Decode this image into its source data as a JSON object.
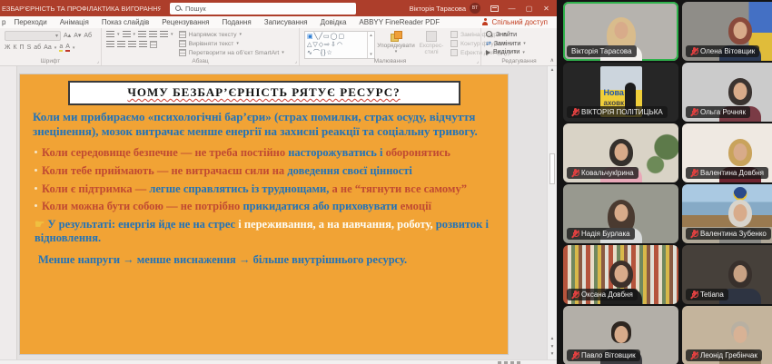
{
  "window": {
    "title": "ЕЗБАР’ЄРНІСТЬ ТА ПРОФІЛАКТИКА ВИГОРАННЯ - PowerPoint",
    "search_placeholder": "Пошук",
    "user_name": "Вікторія Тарасова",
    "user_initials": "ВТ",
    "minimize": "—",
    "restore": "▢",
    "close": "✕"
  },
  "ribbon": {
    "tab_partial": "р",
    "tabs": [
      "Переходи",
      "Анімація",
      "Показ слайдів",
      "Рецензування",
      "Подання",
      "Записування",
      "Довідка",
      "ABBYY FineReader PDF"
    ],
    "share_label": "Спільний доступ",
    "groups": {
      "font": "Шрифт",
      "paragraph": "Абзац",
      "drawing": "Малювання",
      "editing": "Редагування"
    },
    "paragraph_buttons": [
      "Напрямок тексту",
      "Вирівняти текст",
      "Перетворити на об’єкт SmartArt"
    ],
    "drawing_buttons": {
      "arrange": "Упорядкувати",
      "quick_styles_1": "Експрес-",
      "quick_styles_2": "стилі",
      "replace_shape": "Заміна фігури",
      "shape_outline": "Контур фігури",
      "shape_effects": "Ефекти для фігур"
    },
    "editing_buttons": {
      "find": "Знайти",
      "replace": "Замінити",
      "select": "Виділити"
    }
  },
  "slide": {
    "title": "ЧОМУ БЕЗБАР’ЄРНІСТЬ РЯТУЄ РЕСУРС?",
    "intro": "Коли ми прибираємо «психологічні бар’єри» (страх помилки, страх осуду, відчуття знецінення), мозок витрачає менше енергії на захисні реакції та соціальну тривогу.",
    "colors": {
      "background": "#F1A335",
      "blue": "#2173B9",
      "red": "#C04A32",
      "white": "#FDFDF5",
      "speaking_green": "#2FB24C"
    },
    "bullets": [
      {
        "s0": "Коли середовище безпечне — не треба постійно ",
        "s1": "насторожуватись і ",
        "s2": "оборонятись"
      },
      {
        "s0": "Коли тебе приймають — не витрачаєш сили на ",
        "s1": "доведення своєї цінності"
      },
      {
        "s0": "Коли є підтримка — ",
        "s1": "легше справлятись із труднощами, ",
        "s2": "а не “тягнути все самому”"
      },
      {
        "s0": "Коли можна бути собою — не потрібно ",
        "s1": "прикидатися або приховувати ",
        "s2": "емоції"
      },
      {
        "hand": "☛ ",
        "s0": "У результаті: ",
        "s1": "енергія йде не на стрес ",
        "s2": "і переживання, а на навчання, роботу, ",
        "s3": "розвиток і відновлення."
      },
      {
        "s0": "Менше напруги → менше виснаження → більше внутрішнього ресурсу."
      }
    ]
  },
  "meeting": {
    "participants": [
      {
        "name": "Вікторія Тарасова",
        "muted": false,
        "speaking": true
      },
      {
        "name": "Олена Вітовщик",
        "muted": true
      },
      {
        "name": "ВІКТОРІЯ ПОЛІТИЦЬКА",
        "muted": true,
        "poster_line1": "Нова",
        "poster_line2": "аховк"
      },
      {
        "name": "Ольга Рочняк",
        "muted": true
      },
      {
        "name": "КовальчукІрина",
        "muted": true
      },
      {
        "name": "Валентина Довбня",
        "muted": true
      },
      {
        "name": "Надія Бурлака",
        "muted": true
      },
      {
        "name": "Валентина Зубенко",
        "muted": true
      },
      {
        "name": "Оксана Довбня",
        "muted": true
      },
      {
        "name": "Tetiana",
        "muted": true
      },
      {
        "name": "Павло Вітовщик",
        "muted": true
      },
      {
        "name": "Леонід Гребінчак",
        "muted": true
      }
    ]
  }
}
